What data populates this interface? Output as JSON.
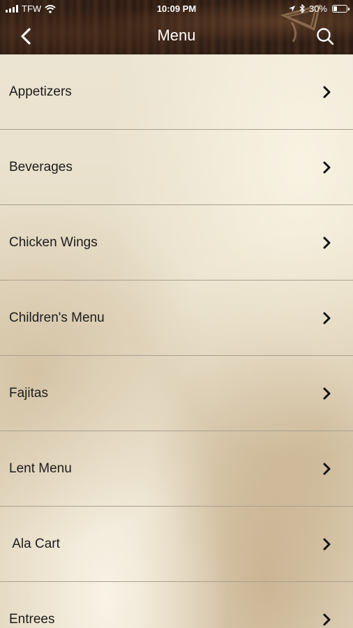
{
  "status_bar": {
    "carrier": "TFW",
    "time": "10:09 PM",
    "battery_text": "30%",
    "battery_level": 0.3
  },
  "nav": {
    "title": "Menu",
    "back_icon": "chevron-left-icon",
    "search_icon": "search-icon"
  },
  "menu": {
    "items": [
      {
        "label": "Appetizers"
      },
      {
        "label": "Beverages"
      },
      {
        "label": "Chicken Wings"
      },
      {
        "label": "Children's Menu"
      },
      {
        "label": "Fajitas"
      },
      {
        "label": "Lent Menu"
      },
      {
        "label": " Ala Cart"
      },
      {
        "label": "Entrees"
      }
    ]
  },
  "colors": {
    "header_bg": "#2f1e15",
    "list_bg": "#e9e1cf",
    "divider": "#a8a090",
    "text": "#1c1c1c"
  }
}
